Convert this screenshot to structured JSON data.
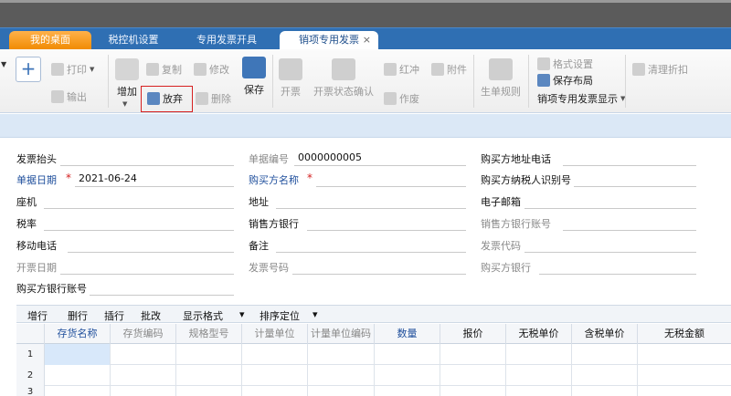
{
  "tabs": {
    "home": "我的桌面",
    "tax_settings": "税控机设置",
    "special_invoice": "专用发票开具",
    "sales_invoice": "销项专用发票",
    "close": "×"
  },
  "toolbar": {
    "add_plus": "+",
    "print": "打印",
    "export": "输出",
    "add": "增加",
    "copy": "复制",
    "modify": "修改",
    "abandon": "放弃",
    "delete": "删除",
    "save": "保存",
    "issue": "开票",
    "issue_confirm": "开票状态确认",
    "red": "红冲",
    "void": "作废",
    "attachment": "附件",
    "generate_rule": "生单规则",
    "format_settings": "格式设置",
    "save_layout": "保存布局",
    "display_dropdown": "销项专用发票显示",
    "clear_discount": "清理折扣"
  },
  "form": {
    "invoice_header": {
      "label": "发票抬头",
      "value": ""
    },
    "doc_no": {
      "label": "单据编号",
      "value": "0000000005"
    },
    "buyer_addr_phone": {
      "label": "购买方地址电话",
      "value": ""
    },
    "doc_date": {
      "label": "单据日期",
      "value": "2021-06-24"
    },
    "buyer_name": {
      "label": "购买方名称",
      "value": ""
    },
    "buyer_tax_id": {
      "label": "购买方纳税人识别号",
      "value": ""
    },
    "landline": {
      "label": "座机",
      "value": ""
    },
    "address": {
      "label": "地址",
      "value": ""
    },
    "email": {
      "label": "电子邮箱",
      "value": ""
    },
    "tax_rate": {
      "label": "税率",
      "value": ""
    },
    "seller_bank": {
      "label": "销售方银行",
      "value": ""
    },
    "seller_bank_account": {
      "label": "销售方银行账号",
      "value": ""
    },
    "mobile": {
      "label": "移动电话",
      "value": ""
    },
    "remark": {
      "label": "备注",
      "value": ""
    },
    "invoice_code": {
      "label": "发票代码",
      "value": ""
    },
    "invoice_date": {
      "label": "开票日期",
      "value": ""
    },
    "invoice_number": {
      "label": "发票号码",
      "value": ""
    },
    "buyer_bank": {
      "label": "购买方银行",
      "value": ""
    },
    "buyer_bank_account": {
      "label": "购买方银行账号",
      "value": ""
    },
    "required_mark": "*"
  },
  "grid_toolbar": {
    "add_row": "增行",
    "delete_row": "删行",
    "insert_row": "插行",
    "batch_change": "批改",
    "display_format": "显示格式",
    "sort_locate": "排序定位",
    "dropdown": "▾"
  },
  "grid": {
    "columns": [
      "存货名称",
      "存货编码",
      "规格型号",
      "计量单位",
      "计量单位编码",
      "数量",
      "报价",
      "无税单价",
      "含税单价",
      "无税金额"
    ],
    "rows": [
      "1",
      "2",
      "3"
    ]
  }
}
